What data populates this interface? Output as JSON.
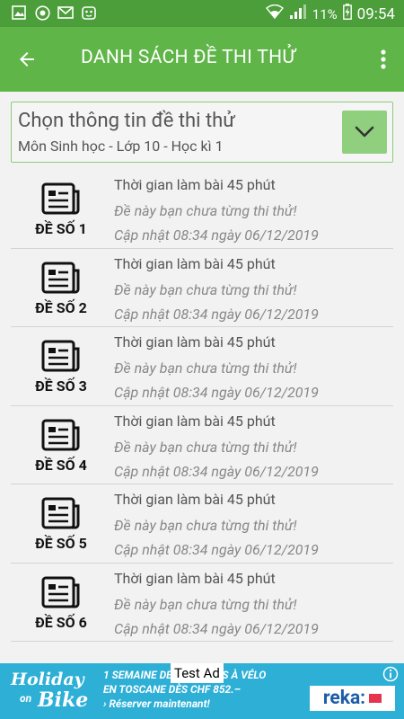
{
  "status_bar": {
    "battery_percent": "11%",
    "time": "09:54",
    "icons": [
      "image-icon",
      "chrome-icon",
      "gmail-icon",
      "app-icon",
      "wifi-icon",
      "signal-icon",
      "battery-charging-icon"
    ]
  },
  "app_bar": {
    "title": "DANH SÁCH ĐỀ THI THỬ",
    "back_icon": "arrow-back-icon",
    "menu_icon": "more-vert-icon"
  },
  "selector": {
    "title": "Chọn thông tin đề thi thử",
    "subtitle": "Môn Sinh học - Lớp 10 - Học kì 1",
    "dropdown_icon": "chevron-down-icon"
  },
  "exams": [
    {
      "label": "ĐỀ SỐ 1",
      "time": "Thời gian làm bài 45 phút",
      "status": "Đề này bạn chưa từng thi thử!",
      "updated": "Cập nhật 08:34 ngày 06/12/2019"
    },
    {
      "label": "ĐỀ SỐ 2",
      "time": "Thời gian làm bài 45 phút",
      "status": "Đề này bạn chưa từng thi thử!",
      "updated": "Cập nhật 08:34 ngày 06/12/2019"
    },
    {
      "label": "ĐỀ SỐ 3",
      "time": "Thời gian làm bài 45 phút",
      "status": "Đề này bạn chưa từng thi thử!",
      "updated": "Cập nhật 08:34 ngày 06/12/2019"
    },
    {
      "label": "ĐỀ SỐ 4",
      "time": "Thời gian làm bài 45 phút",
      "status": "Đề này bạn chưa từng thi thử!",
      "updated": "Cập nhật 08:34 ngày 06/12/2019"
    },
    {
      "label": "ĐỀ SỐ 5",
      "time": "Thời gian làm bài 45 phút",
      "status": "Đề này bạn chưa từng thi thử!",
      "updated": "Cập nhật 08:34 ngày 06/12/2019"
    },
    {
      "label": "ĐỀ SỐ 6",
      "time": "Thời gian làm bài 45 phút",
      "status": "Đề này bạn chưa từng thi thử!",
      "updated": "Cập nhật 08:34 ngày 06/12/2019"
    }
  ],
  "ad": {
    "label": "Test Ad",
    "logo_line1": "Holiday",
    "logo_line2": "on",
    "logo_line3": "Bike",
    "text_line1": "1 SEMAINE DE VACANCES À VÉLO",
    "text_line2": "EN TOSCANE DÈS CHF 852.–",
    "text_line3": "› Réserver maintenant!",
    "brand": "reka:"
  },
  "colors": {
    "status_bar": "#4b9e3a",
    "app_bar": "#5fb548",
    "dropdown_bg": "#8fcf7d",
    "ad_bg": "#2dafd6"
  }
}
